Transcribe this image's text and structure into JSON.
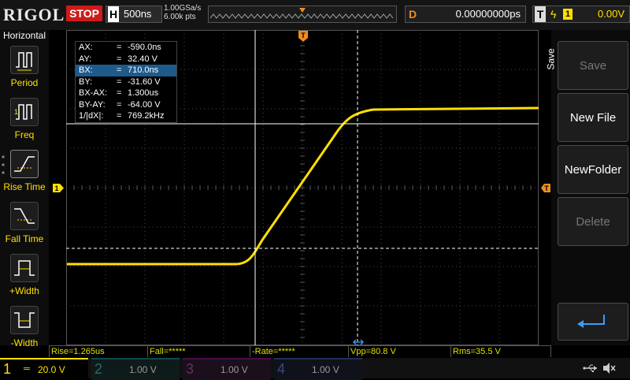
{
  "header": {
    "brand": "RIGOL",
    "run_state": "STOP",
    "timebase_label": "H",
    "timebase_value": "500ns",
    "sample_rate": "1.00GSa/s",
    "memory_depth": "6.00k pts",
    "delay_label": "D",
    "delay_value": "0.00000000ps",
    "trigger_label": "T",
    "trigger_channel": "1",
    "trigger_level": "0.00V"
  },
  "left_menu": {
    "title": "Horizontal",
    "items": [
      {
        "label": "Period",
        "icon": "period-icon"
      },
      {
        "label": "Freq",
        "icon": "frequency-icon"
      },
      {
        "label": "Rise Time",
        "icon": "rise-time-icon"
      },
      {
        "label": "Fall Time",
        "icon": "fall-time-icon"
      },
      {
        "label": "+Width",
        "icon": "positive-width-icon"
      },
      {
        "label": "-Width",
        "icon": "negative-width-icon"
      }
    ]
  },
  "right_menu": {
    "title": "Save",
    "buttons": [
      {
        "label": "Save",
        "enabled": false
      },
      {
        "label": "New File",
        "enabled": true
      },
      {
        "label": "NewFolder",
        "enabled": true
      },
      {
        "label": "Delete",
        "enabled": false
      }
    ],
    "return_icon": "return-arrow-icon"
  },
  "cursor_table": {
    "rows": [
      {
        "name": "AX:",
        "eq": "=",
        "value": "-590.0ns",
        "selected": false
      },
      {
        "name": "AY:",
        "eq": "=",
        "value": "32.40 V",
        "selected": false
      },
      {
        "name": "BX:",
        "eq": "=",
        "value": "710.0ns",
        "selected": true
      },
      {
        "name": "BY:",
        "eq": "=",
        "value": "-31.60 V",
        "selected": false
      },
      {
        "name": "BX-AX:",
        "eq": "=",
        "value": "1.300us",
        "selected": false
      },
      {
        "name": "BY-AY:",
        "eq": "=",
        "value": "-64.00 V",
        "selected": false
      },
      {
        "name": "1/|dX|:",
        "eq": "=",
        "value": "769.2kHz",
        "selected": false
      }
    ]
  },
  "measurements": [
    "Rise=1.265us",
    "Fall=*****",
    "-Rate=*****",
    "Vpp=80.8 V",
    "Rms=35.5 V"
  ],
  "channels": [
    {
      "num": "1",
      "scale": "20.0 V",
      "color": "#ffe000",
      "active": true
    },
    {
      "num": "2",
      "scale": "1.00 V",
      "color": "#00c8c8",
      "active": false
    },
    {
      "num": "3",
      "scale": "1.00 V",
      "color": "#c800c8",
      "active": false
    },
    {
      "num": "4",
      "scale": "1.00 V",
      "color": "#3c78ff",
      "active": false
    }
  ],
  "colors": {
    "ch1": "#ffe000",
    "trigger": "#f08c20",
    "stop": "#cc1b1b",
    "selected": "#1e5b8c"
  },
  "status_icons": [
    "usb-icon",
    "sound-muted-icon"
  ]
}
